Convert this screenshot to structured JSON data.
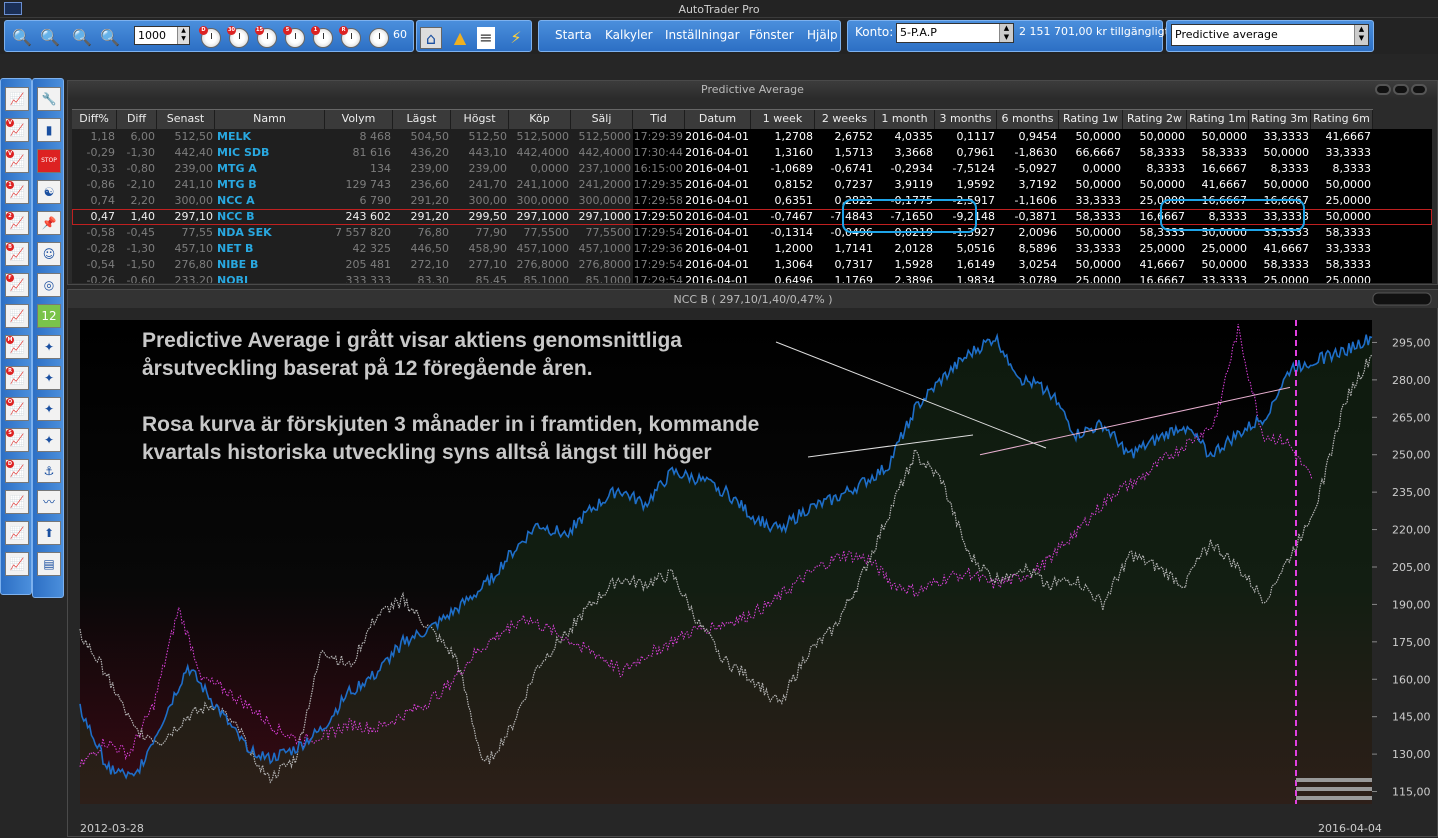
{
  "window": {
    "title": "AutoTrader Pro"
  },
  "toolbar": {
    "quantity": "1000",
    "interval_value": "60",
    "clock_badges": [
      "D",
      "30",
      "15",
      "5",
      "1",
      "R"
    ],
    "menu": [
      "Starta",
      "Kalkyler",
      "Inställningar",
      "Fönster",
      "Hjälp"
    ],
    "konto_label": "Konto:",
    "konto_value": "5-P.A.P",
    "balance": "2 151 701,00 kr tillgängligt",
    "view_select": "Predictive average"
  },
  "sidebar": {
    "col1_badges": [
      "",
      "V",
      "V",
      "1",
      "2",
      "B",
      "F",
      "",
      "M",
      "R",
      "O",
      "S",
      "D",
      "",
      "",
      ""
    ],
    "col2_icons": [
      "wrench-icon",
      "bar-chart-icon",
      "stop-icon",
      "yin-yang-icon",
      "pin-icon",
      "avatar",
      "swirl-icon",
      "calendar-icon",
      "compass-icon",
      "navigator-icon",
      "navigator-icon",
      "navigator-icon",
      "anchor-icon",
      "line-chart-icon",
      "arrow-up-icon",
      "document-icon"
    ],
    "calendar_day": "12",
    "stop_label": "STOP"
  },
  "grid": {
    "title": "Predictive Average",
    "columns": [
      "Diff%",
      "Diff",
      "Senast",
      "Namn",
      "Volym",
      "Lägst",
      "Högst",
      "Köp",
      "Sälj",
      "Tid",
      "Datum",
      "1 week",
      "2 weeks",
      "1 month",
      "3 months",
      "6 months",
      "Rating 1w",
      "Rating 2w",
      "Rating 1m",
      "Rating 3m",
      "Rating 6m"
    ],
    "rows": [
      [
        "1,18",
        "6,00",
        "512,50",
        "MELK",
        "8 468",
        "504,50",
        "512,50",
        "512,5000",
        "512,5000",
        "17:29:39",
        "2016-04-01",
        "1,2708",
        "2,6752",
        "4,0335",
        "0,1117",
        "0,9454",
        "50,0000",
        "50,0000",
        "50,0000",
        "33,3333",
        "41,6667"
      ],
      [
        "-0,29",
        "-1,30",
        "442,40",
        "MIC SDB",
        "81 616",
        "436,20",
        "443,10",
        "442,4000",
        "442,4000",
        "17:30:44",
        "2016-04-01",
        "1,3160",
        "1,5713",
        "3,3668",
        "0,7961",
        "-1,8630",
        "66,6667",
        "58,3333",
        "58,3333",
        "50,0000",
        "33,3333"
      ],
      [
        "-0,33",
        "-0,80",
        "239,00",
        "MTG A",
        "134",
        "239,00",
        "239,00",
        "0,0000",
        "237,1000",
        "16:15:00",
        "2016-04-01",
        "-1,0689",
        "-0,6741",
        "-0,2934",
        "-7,5124",
        "-5,0927",
        "0,0000",
        "8,3333",
        "16,6667",
        "8,3333",
        "8,3333"
      ],
      [
        "-0,86",
        "-2,10",
        "241,10",
        "MTG B",
        "129 743",
        "236,60",
        "241,70",
        "241,1000",
        "241,2000",
        "17:29:35",
        "2016-04-01",
        "0,8152",
        "0,7237",
        "3,9119",
        "1,9592",
        "3,7192",
        "50,0000",
        "50,0000",
        "41,6667",
        "50,0000",
        "50,0000"
      ],
      [
        "0,74",
        "2,20",
        "300,00",
        "NCC A",
        "6 790",
        "291,20",
        "300,00",
        "300,0000",
        "300,0000",
        "17:29:58",
        "2016-04-01",
        "0,6351",
        "0,2822",
        "-0,1775",
        "-2,5917",
        "-1,1606",
        "33,3333",
        "25,0000",
        "16,6667",
        "16,6667",
        "25,0000"
      ],
      [
        "0,47",
        "1,40",
        "297,10",
        "NCC B",
        "243 602",
        "291,20",
        "299,50",
        "297,1000",
        "297,1000",
        "17:29:50",
        "2016-04-01",
        "-0,7467",
        "-7,4843",
        "-7,1650",
        "-9,2148",
        "-0,3871",
        "58,3333",
        "16,6667",
        "8,3333",
        "33,3333",
        "50,0000"
      ],
      [
        "-0,58",
        "-0,45",
        "77,55",
        "NDA SEK",
        "7 557 820",
        "76,80",
        "77,90",
        "77,5500",
        "77,5500",
        "17:29:54",
        "2016-04-01",
        "-0,1314",
        "-0,0496",
        "0,0219",
        "-1,3927",
        "2,0096",
        "50,0000",
        "58,3333",
        "50,0000",
        "33,3333",
        "58,3333"
      ],
      [
        "-0,28",
        "-1,30",
        "457,10",
        "NET B",
        "42 325",
        "446,50",
        "458,90",
        "457,1000",
        "457,1000",
        "17:29:36",
        "2016-04-01",
        "1,2000",
        "1,7141",
        "2,0128",
        "5,0516",
        "8,5896",
        "33,3333",
        "25,0000",
        "25,0000",
        "41,6667",
        "33,3333"
      ],
      [
        "-0,54",
        "-1,50",
        "276,80",
        "NIBE B",
        "205 481",
        "272,10",
        "277,10",
        "276,8000",
        "276,8000",
        "17:29:54",
        "2016-04-01",
        "1,3064",
        "0,7317",
        "1,5928",
        "1,6149",
        "3,0254",
        "50,0000",
        "41,6667",
        "50,0000",
        "58,3333",
        "58,3333"
      ],
      [
        "-0,26",
        "-0,60",
        "233,20",
        "NOBI",
        "333 333",
        "83,30",
        "85,45",
        "85,1000",
        "85,1000",
        "17:29:54",
        "2016-04-01",
        "0,6496",
        "1,1769",
        "2,3896",
        "1,9834",
        "3,0789",
        "25,0000",
        "16,6667",
        "33,3333",
        "25,0000",
        "25,0000"
      ]
    ],
    "selected_row": 5
  },
  "chart": {
    "title": "NCC B ( 297,10/1,40/0,47% )",
    "date_start": "2012-03-28",
    "date_end": "2016-04-04",
    "annotation1": [
      "Predictive Average i grått visar aktiens genomsnittliga",
      "årsutveckling baserat på 12 föregående åren."
    ],
    "annotation2": [
      "Rosa kurva är förskjuten 3 månader in i framtiden, kommande",
      "kvartals historiska utveckling syns alltså längst till höger"
    ],
    "colors": {
      "price": "#1e6ec8",
      "predictive": "#b4b4b4",
      "shifted": "#e040e0",
      "trend": "#e8b0d0"
    }
  },
  "chart_data": {
    "type": "line",
    "x_range": [
      "2012-03-28",
      "2016-04-04"
    ],
    "yticks": [
      "295,00",
      "280,00",
      "265,00",
      "250,00",
      "235,00",
      "220,00",
      "205,00",
      "190,00",
      "175,00",
      "160,00",
      "145,00",
      "130,00",
      "115,00"
    ],
    "ylim": [
      110,
      304
    ],
    "series": [
      {
        "values": [
          148,
          125,
          120,
          142,
          165,
          150,
          135,
          128,
          132,
          140,
          155,
          162,
          175,
          180,
          188,
          197,
          210,
          222,
          218,
          228,
          236,
          230,
          243,
          240,
          235,
          225,
          220,
          228,
          232,
          238,
          245,
          268,
          280,
          290,
          297,
          280,
          276,
          258,
          262,
          250,
          256,
          262,
          250,
          258,
          265,
          285,
          288,
          292,
          297
        ]
      },
      {
        "values": [
          178,
          162,
          140,
          135,
          145,
          150,
          138,
          120,
          128,
          172,
          165,
          185,
          192,
          180,
          168,
          125,
          140,
          165,
          178,
          190,
          200,
          198,
          202,
          182,
          167,
          160,
          150,
          170,
          180,
          200,
          225,
          250,
          240,
          210,
          200,
          205,
          198,
          200,
          190,
          210,
          205,
          198,
          215,
          205,
          192,
          210,
          232,
          272,
          290
        ]
      },
      {
        "values": [
          125,
          135,
          130,
          150,
          188,
          160,
          155,
          148,
          140,
          135,
          138,
          142,
          140,
          145,
          150,
          158,
          170,
          178,
          185,
          180,
          175,
          170,
          163,
          170,
          175,
          180,
          182,
          185,
          190,
          198,
          205,
          210,
          208,
          198,
          195,
          200,
          203,
          198,
          200,
          205,
          215,
          225,
          235,
          240,
          248,
          255,
          262,
          300,
          258,
          255,
          240
        ]
      }
    ]
  }
}
